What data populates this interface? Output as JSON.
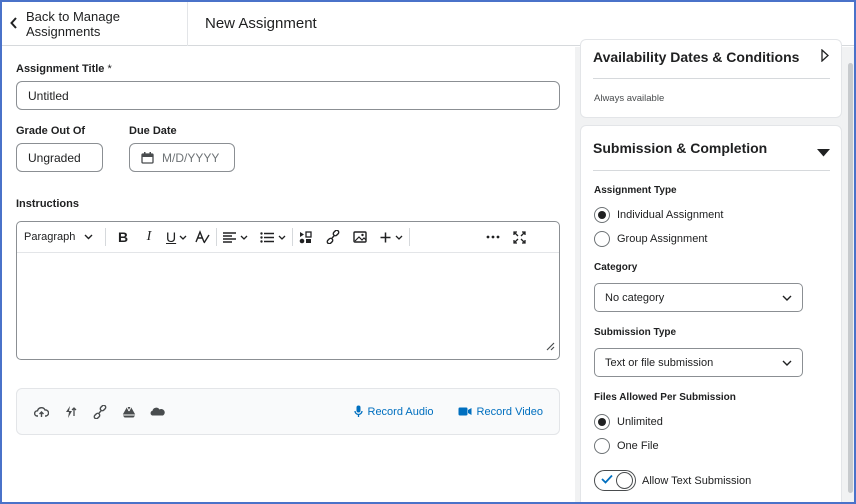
{
  "header": {
    "back_label": "Back to Manage Assignments",
    "page_title": "New Assignment"
  },
  "form": {
    "title_label": "Assignment Title",
    "title_required_mark": "*",
    "title_value": "Untitled",
    "grade_label": "Grade Out Of",
    "grade_value": "Ungraded",
    "due_label": "Due Date",
    "due_placeholder": "M/D/YYYY",
    "instructions_label": "Instructions"
  },
  "editor": {
    "paragraph_label": "Paragraph",
    "icons": [
      "bold-icon",
      "italic-icon",
      "underline-icon",
      "text-format-icon",
      "align-icon",
      "list-icon",
      "insert-element-icon",
      "link-icon",
      "image-icon",
      "plus-icon",
      "more-icon",
      "fullscreen-icon"
    ]
  },
  "attachments": {
    "icons": [
      "upload-icon",
      "quicklink-icon",
      "link-icon",
      "google-drive-icon",
      "onedrive-icon"
    ],
    "record_audio": "Record Audio",
    "record_video": "Record Video",
    "accent": "#006fbf"
  },
  "availability": {
    "title": "Availability Dates & Conditions",
    "status": "Always available"
  },
  "submission": {
    "title": "Submission & Completion",
    "type_label": "Assignment Type",
    "type_options": [
      "Individual Assignment",
      "Group Assignment"
    ],
    "type_selected": "Individual Assignment",
    "category_label": "Category",
    "category_value": "No category",
    "submission_type_label": "Submission Type",
    "submission_type_value": "Text or file submission",
    "files_label": "Files Allowed Per Submission",
    "files_options": [
      "Unlimited",
      "One File"
    ],
    "files_selected": "Unlimited",
    "allow_text_label": "Allow Text Submission",
    "allow_text_on": true
  }
}
